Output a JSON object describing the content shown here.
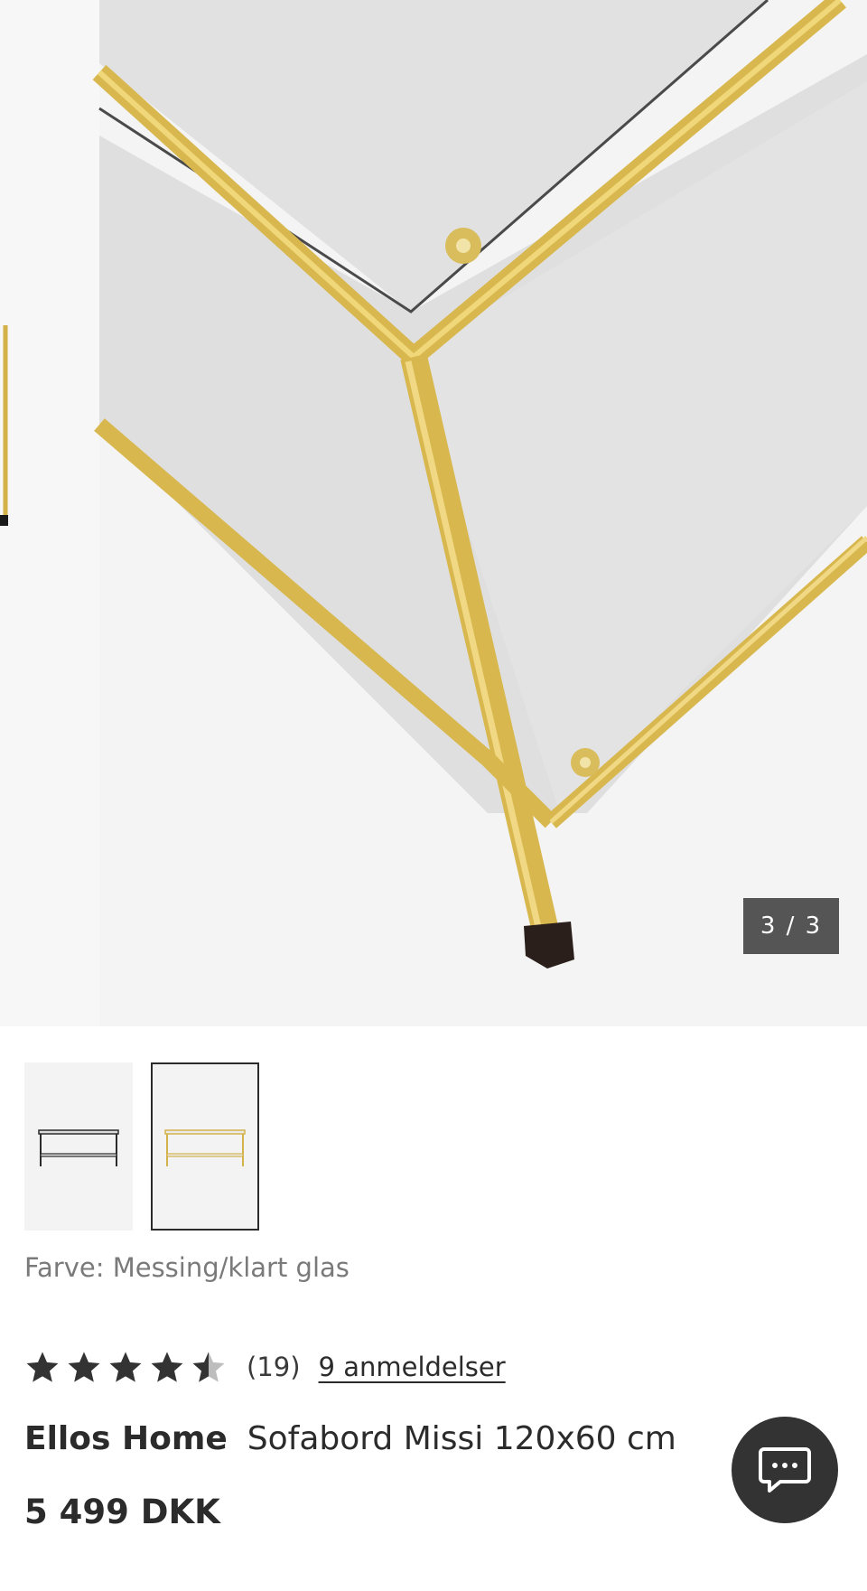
{
  "gallery": {
    "counter": "3 / 3",
    "thumbnails": [
      {
        "alt": "Sofabord sort/klart glas",
        "frame_color": "#2b2b2b",
        "selected": false
      },
      {
        "alt": "Sofabord messing/klart glas",
        "frame_color": "#d4b24a",
        "selected": true
      }
    ]
  },
  "product": {
    "color_label": "Farve: Messing/klart glas",
    "rating_value": 4.5,
    "rating_count": "(19)",
    "reviews_link": "9 anmeldelser",
    "brand": "Ellos Home",
    "name": "Sofabord Missi 120x60 cm",
    "price": "5 499 DKK"
  },
  "chat": {
    "icon": "chat-bubble-icon"
  },
  "colors": {
    "brass": "#d4b24a",
    "text": "#2b2b2b",
    "counter_bg": "#555555"
  }
}
